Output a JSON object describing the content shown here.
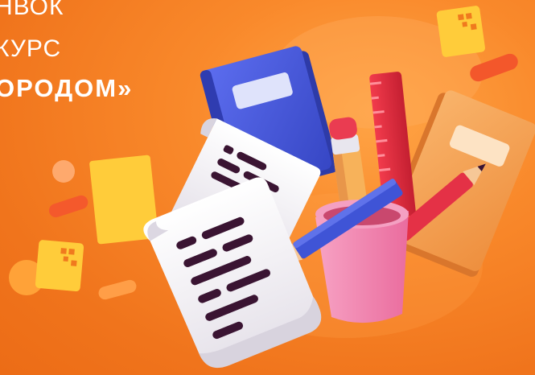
{
  "headline": {
    "line1": "НВОК",
    "line2": "КУРС",
    "line3": "ОРОДОМ»"
  },
  "colors": {
    "background": "#f07a1e",
    "text": "#ffffff",
    "notebook_blue": "#4a5cd8",
    "notebook_orange": "#f5a35a",
    "cup": "#f58fb4",
    "pencil": "#3f54d6",
    "ruler": "#e52a3c",
    "sticky": "#ffcc3a",
    "ink": "#3a1432"
  },
  "icons": [
    "sticky-note-icon",
    "notebook-icon",
    "paper-scroll-icon",
    "pencil-cup-icon",
    "ruler-icon",
    "pencil-icon"
  ]
}
